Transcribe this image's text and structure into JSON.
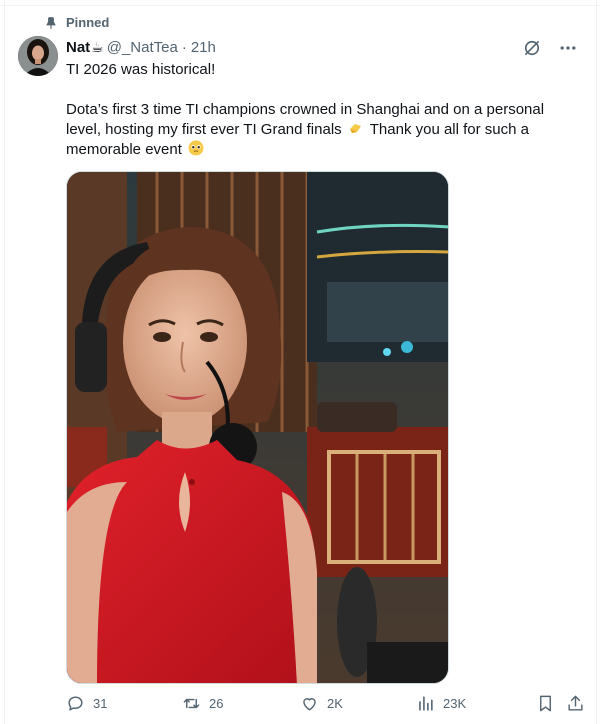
{
  "pinned_label": "Pinned",
  "author": {
    "name": "Nat",
    "name_emoji": "☕",
    "handle": "@_NatTea",
    "separator": "·",
    "time": "21h"
  },
  "tweet": {
    "line1": "TI 2026 was historical!",
    "line2_before_emoji": "Dota’s first 3 time TI champions crowned in Shanghai and on a personal level, hosting my first ever TI Grand finals",
    "line2_after_emoji": "Thank you all for such a memorable event"
  },
  "actions": {
    "replies": "31",
    "retweets": "26",
    "likes": "2K",
    "views": "23K"
  },
  "colors": {
    "text_primary": "#0f1419",
    "text_secondary": "#536471",
    "border": "#eff3f4",
    "dress_red": "#d3171f"
  },
  "icons": [
    "pin-icon",
    "grok-slash-icon",
    "more-icon",
    "reply-icon",
    "retweet-icon",
    "like-icon",
    "views-icon",
    "bookmark-icon",
    "share-icon"
  ]
}
